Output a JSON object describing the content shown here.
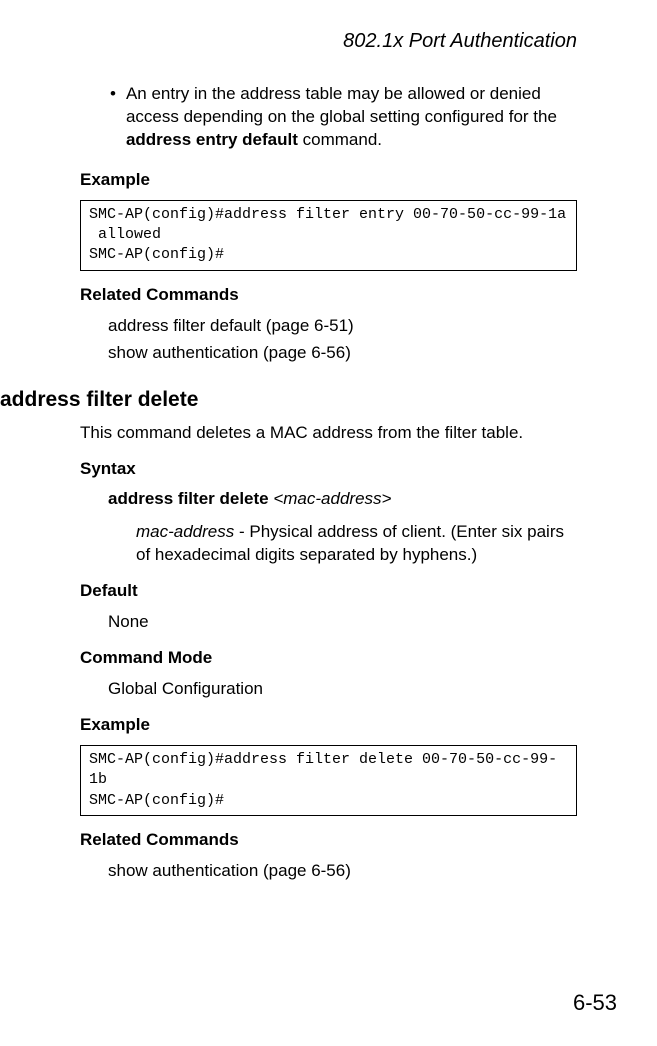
{
  "header": {
    "title": "802.1x Port Authentication"
  },
  "bullet": {
    "text_part1": "An entry in the address table may be allowed or denied access depending on the global setting configured for the ",
    "text_bold": "address entry default",
    "text_part2": " command."
  },
  "section1": {
    "example_label": "Example",
    "code": "SMC-AP(config)#address filter entry 00-70-50-cc-99-1a \n allowed\nSMC-AP(config)#",
    "related_label": "Related Commands",
    "related1": "address filter default (page 6-51)",
    "related2": "show authentication (page 6-56)"
  },
  "command": {
    "title": "address filter delete",
    "description": "This command deletes a MAC address from the filter table.",
    "syntax_label": "Syntax",
    "syntax_bold": "address filter delete ",
    "syntax_italic": "<mac-address>",
    "param_name": "mac-address",
    "param_desc": " - Physical address of client. (Enter six pairs of hexadecimal digits separated by hyphens.)",
    "default_label": "Default",
    "default_value": "None",
    "mode_label": "Command Mode",
    "mode_value": "Global Configuration",
    "example_label": "Example",
    "code": "SMC-AP(config)#address filter delete 00-70-50-cc-99-1b \nSMC-AP(config)#",
    "related_label": "Related Commands",
    "related1": "show authentication (page 6-56)"
  },
  "footer": {
    "page": "6-53"
  }
}
